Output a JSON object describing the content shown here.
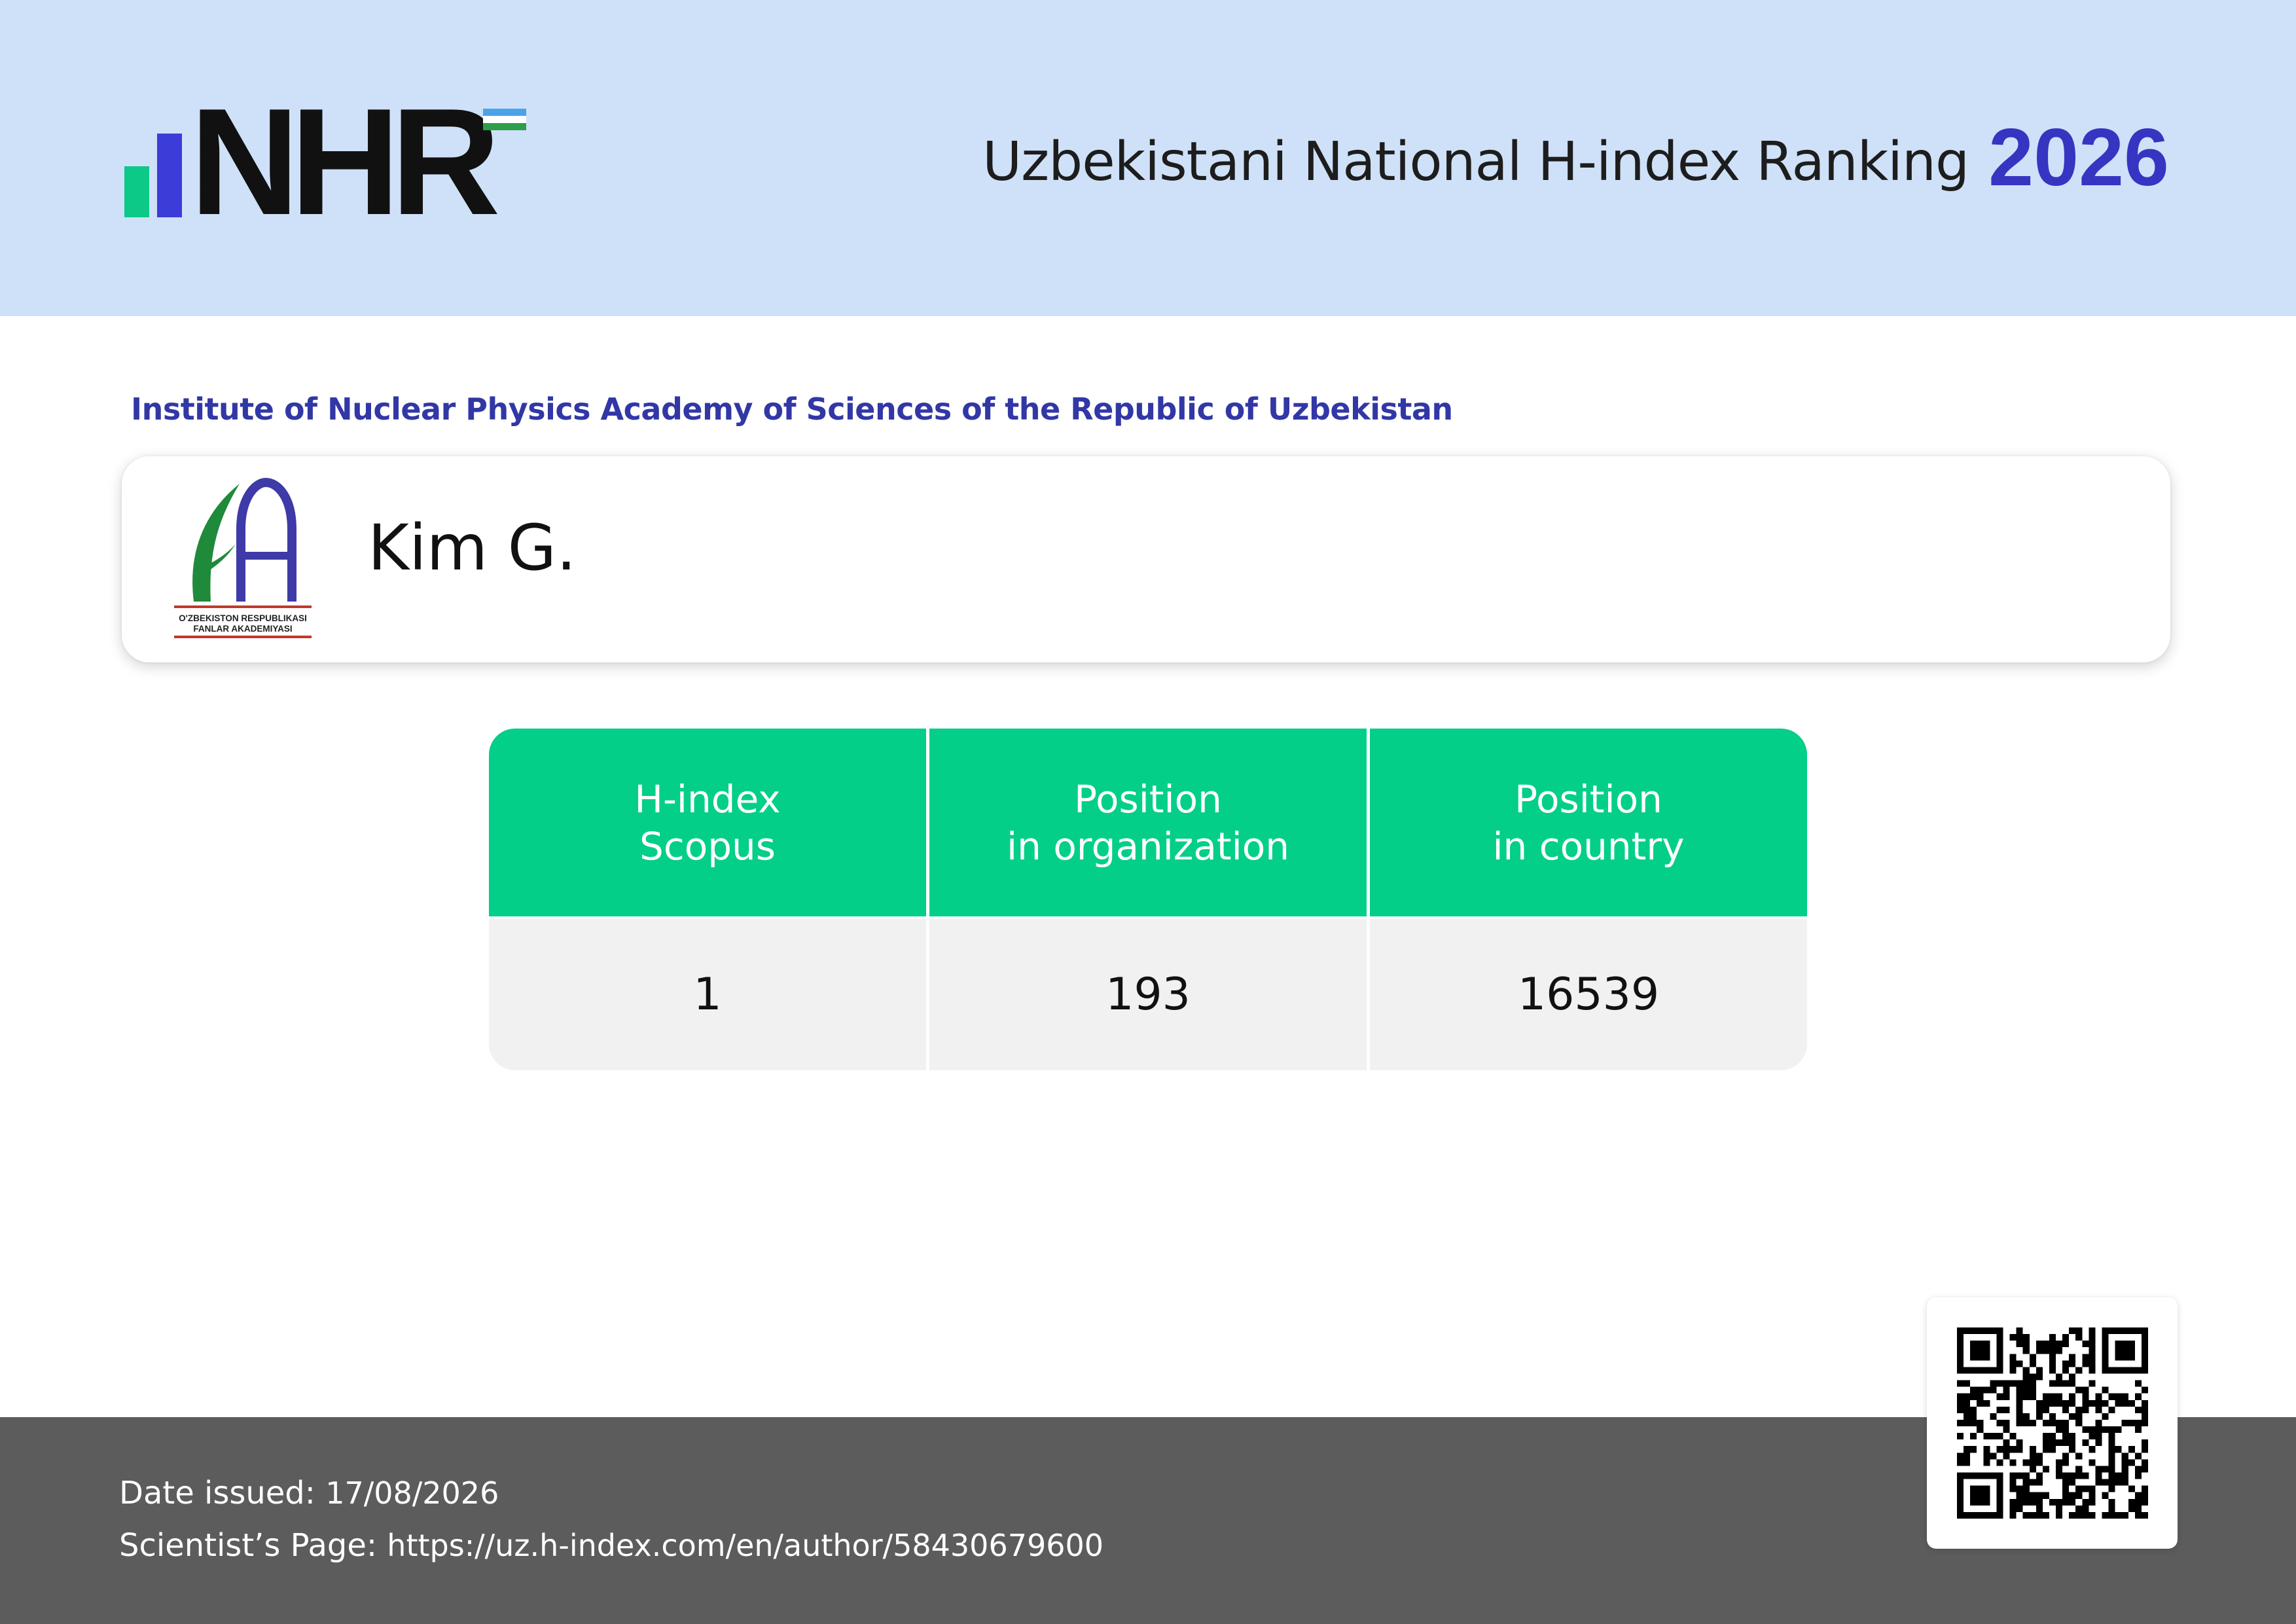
{
  "brand": {
    "logo_text": "NHR",
    "colors": {
      "accent_blue": "#3535c2",
      "accent_green": "#04cf89",
      "header_bg": "#cfe1f8",
      "footer_bg": "#5c5c5c",
      "logo_bar_green": "#0cc987",
      "logo_bar_blue": "#3c3cd8"
    }
  },
  "header": {
    "title": "Uzbekistani National H-index Ranking",
    "year": "2026"
  },
  "organization": "Institute of Nuclear Physics Academy of Sciences of the Republic of Uzbekistan",
  "scientist": {
    "name": "Kim G.",
    "academy_logo_text_line1": "O'ZBEKISTON RESPUBLIKASI",
    "academy_logo_text_line2": "FANLAR AKADEMIYASI"
  },
  "stats": {
    "columns": [
      {
        "line1": "H-index",
        "line2": "Scopus",
        "value": "1"
      },
      {
        "line1": "Position",
        "line2": "in organization",
        "value": "193"
      },
      {
        "line1": "Position",
        "line2": "in country",
        "value": "16539"
      }
    ]
  },
  "footer": {
    "date_label": "Date issued:",
    "date_value": "17/08/2026",
    "page_label": "Scientist’s Page:",
    "page_url": "https://uz.h-index.com/en/author/58430679600"
  },
  "icons": {
    "qr": "qr-code-icon",
    "flag": "uzbekistan-flag-icon",
    "academy": "academy-logo-icon"
  }
}
